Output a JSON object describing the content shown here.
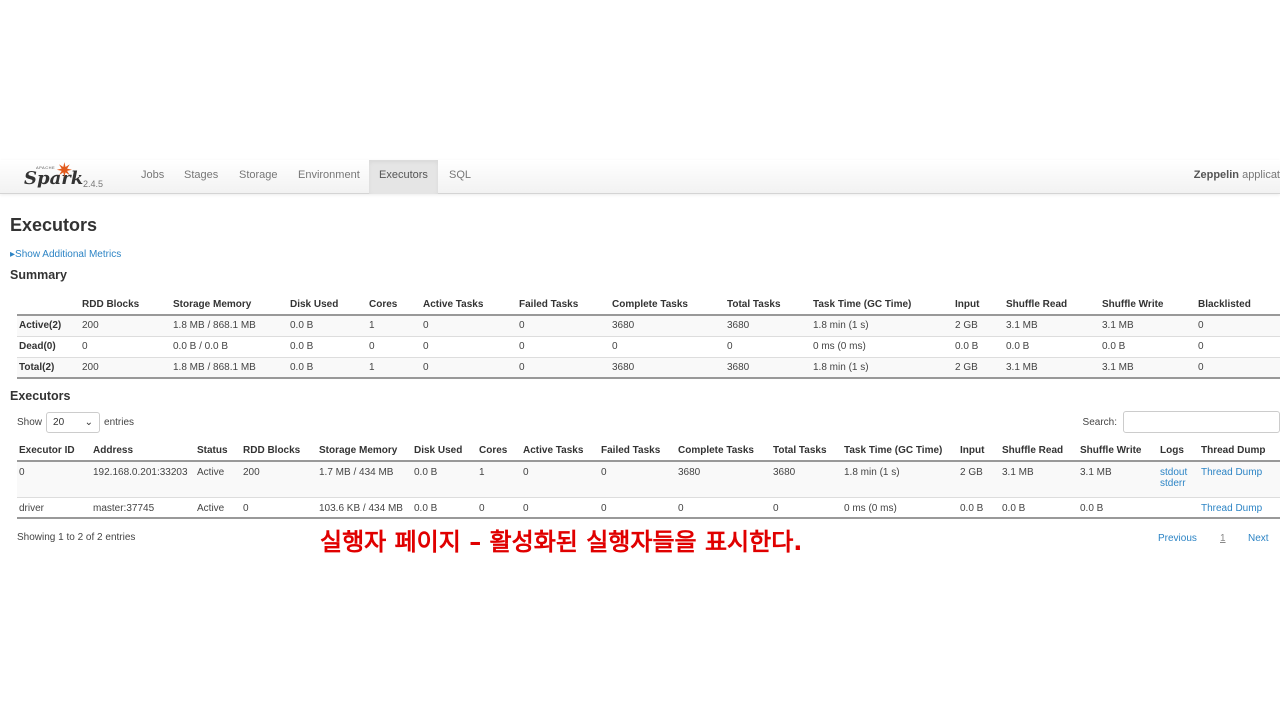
{
  "navbar": {
    "brand_small": "APACHE",
    "brand": "Spark",
    "version": "2.4.5",
    "tabs": [
      "Jobs",
      "Stages",
      "Storage",
      "Environment",
      "Executors",
      "SQL"
    ],
    "active_tab": "Executors",
    "app_name_bold": "Zeppelin",
    "app_name_rest": " applicat"
  },
  "page_title": "Executors",
  "show_metrics": "Show Additional Metrics",
  "summary": {
    "title": "Summary",
    "headers": [
      "",
      "RDD Blocks",
      "Storage Memory",
      "Disk Used",
      "Cores",
      "Active Tasks",
      "Failed Tasks",
      "Complete Tasks",
      "Total Tasks",
      "Task Time (GC Time)",
      "Input",
      "Shuffle Read",
      "Shuffle Write",
      "Blacklisted"
    ],
    "rows": [
      [
        "Active(2)",
        "200",
        "1.8 MB / 868.1 MB",
        "0.0 B",
        "1",
        "0",
        "0",
        "3680",
        "3680",
        "1.8 min (1 s)",
        "2 GB",
        "3.1 MB",
        "3.1 MB",
        "0"
      ],
      [
        "Dead(0)",
        "0",
        "0.0 B / 0.0 B",
        "0.0 B",
        "0",
        "0",
        "0",
        "0",
        "0",
        "0 ms (0 ms)",
        "0.0 B",
        "0.0 B",
        "0.0 B",
        "0"
      ],
      [
        "Total(2)",
        "200",
        "1.8 MB / 868.1 MB",
        "0.0 B",
        "1",
        "0",
        "0",
        "3680",
        "3680",
        "1.8 min (1 s)",
        "2 GB",
        "3.1 MB",
        "3.1 MB",
        "0"
      ]
    ]
  },
  "executors": {
    "title": "Executors",
    "show_label": "Show",
    "entries_value": "20",
    "entries_label": "entries",
    "search_label": "Search:",
    "search_value": "",
    "headers": [
      "Executor ID",
      "Address",
      "Status",
      "RDD Blocks",
      "Storage Memory",
      "Disk Used",
      "Cores",
      "Active Tasks",
      "Failed Tasks",
      "Complete Tasks",
      "Total Tasks",
      "Task Time (GC Time)",
      "Input",
      "Shuffle Read",
      "Shuffle Write",
      "Logs",
      "Thread Dump"
    ],
    "rows": [
      {
        "cells": [
          "0",
          "192.168.0.201:33203",
          "Active",
          "200",
          "1.7 MB / 434 MB",
          "0.0 B",
          "1",
          "0",
          "0",
          "3680",
          "3680",
          "1.8 min (1 s)",
          "2 GB",
          "3.1 MB",
          "3.1 MB"
        ],
        "logs": [
          "stdout",
          "stderr"
        ],
        "thread_dump": "Thread Dump"
      },
      {
        "cells": [
          "driver",
          "master:37745",
          "Active",
          "0",
          "103.6 KB / 434 MB",
          "0.0 B",
          "0",
          "0",
          "0",
          "0",
          "0",
          "0 ms (0 ms)",
          "0.0 B",
          "0.0 B",
          "0.0 B"
        ],
        "logs": [],
        "thread_dump": "Thread Dump"
      }
    ],
    "info": "Showing 1 to 2 of 2 entries",
    "pagination": {
      "previous": "Previous",
      "page": "1",
      "next": "Next"
    }
  },
  "caption": "실행자 페이지 – 활성화된 실행자들을 표시한다.",
  "colors": {
    "accent_link": "#2c84c5",
    "caption": "#e00000",
    "spark_star": "#e25a1c"
  }
}
